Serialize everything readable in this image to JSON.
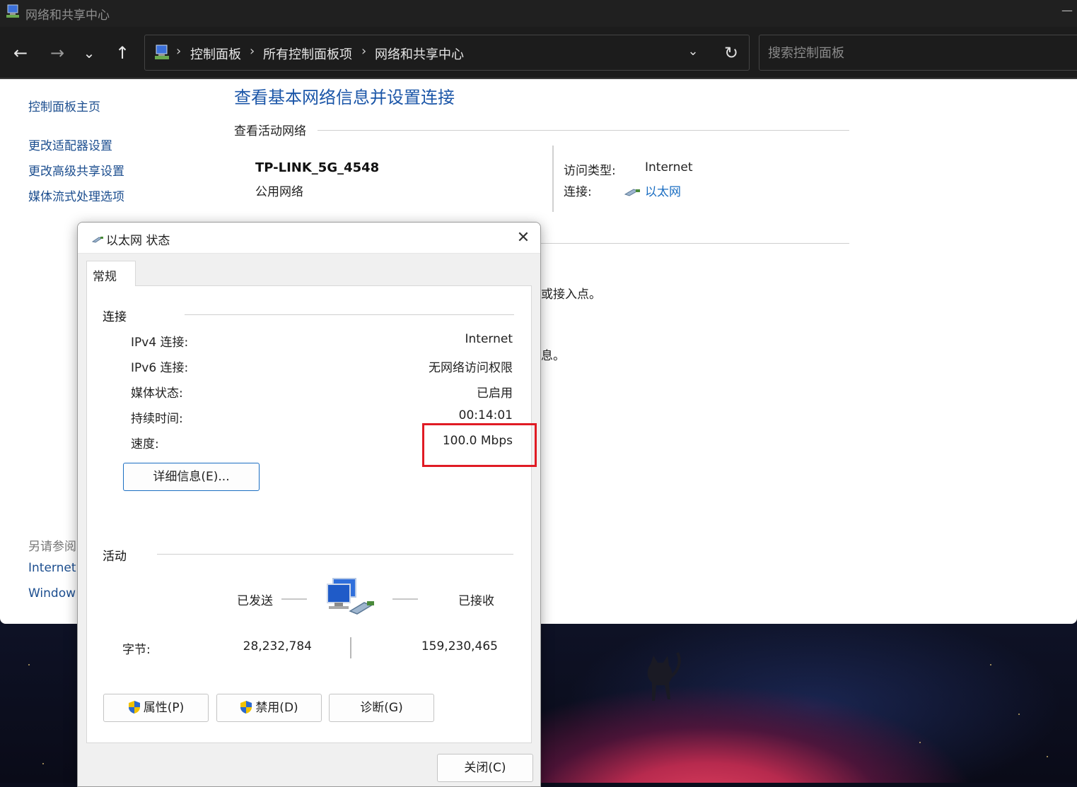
{
  "window": {
    "title": "网络和共享中心",
    "minimize": "—"
  },
  "nav": {
    "back": "←",
    "forward": "→",
    "recent": "⌄",
    "up": "↑",
    "breadcrumbs": [
      "控制面板",
      "所有控制面板项",
      "网络和共享中心"
    ],
    "separator": "›",
    "dropdown": "⌄",
    "refresh": "↻",
    "search_placeholder": "搜索控制面板"
  },
  "sidebar": {
    "home": "控制面板主页",
    "links": [
      "更改适配器设置",
      "更改高级共享设置",
      "媒体流式处理选项"
    ],
    "see_also_heading": "另请参阅",
    "see_also": [
      "Internet",
      "Window"
    ]
  },
  "main": {
    "title": "查看基本网络信息并设置连接",
    "active_networks_heading": "查看活动网络",
    "network_name": "TP-LINK_5G_4548",
    "network_type": "公用网络",
    "access_type_label": "访问类型:",
    "access_type_value": "Internet",
    "connection_label": "连接:",
    "connection_value": "以太网",
    "partial_text_1": "或接入点。",
    "partial_text_2": "息。"
  },
  "dialog": {
    "title": "以太网 状态",
    "close": "✕",
    "tab": "常规",
    "connection_heading": "连接",
    "rows": [
      {
        "label": "IPv4 连接:",
        "value": "Internet"
      },
      {
        "label": "IPv6 连接:",
        "value": "无网络访问权限"
      },
      {
        "label": "媒体状态:",
        "value": "已启用"
      },
      {
        "label": "持续时间:",
        "value": "00:14:01"
      },
      {
        "label": "速度:",
        "value": "100.0 Mbps"
      }
    ],
    "details_button": "详细信息(E)...",
    "activity_heading": "活动",
    "sent_label": "已发送",
    "received_label": "已接收",
    "bytes_label": "字节:",
    "bytes_sent": "28,232,784",
    "bytes_received": "159,230,465",
    "properties_button": "属性(P)",
    "disable_button": "禁用(D)",
    "diagnose_button": "诊断(G)",
    "close_button": "关闭(C)"
  },
  "colors": {
    "highlight": "#e01b24",
    "link": "#1b56a8",
    "titlebar": "#202020"
  }
}
